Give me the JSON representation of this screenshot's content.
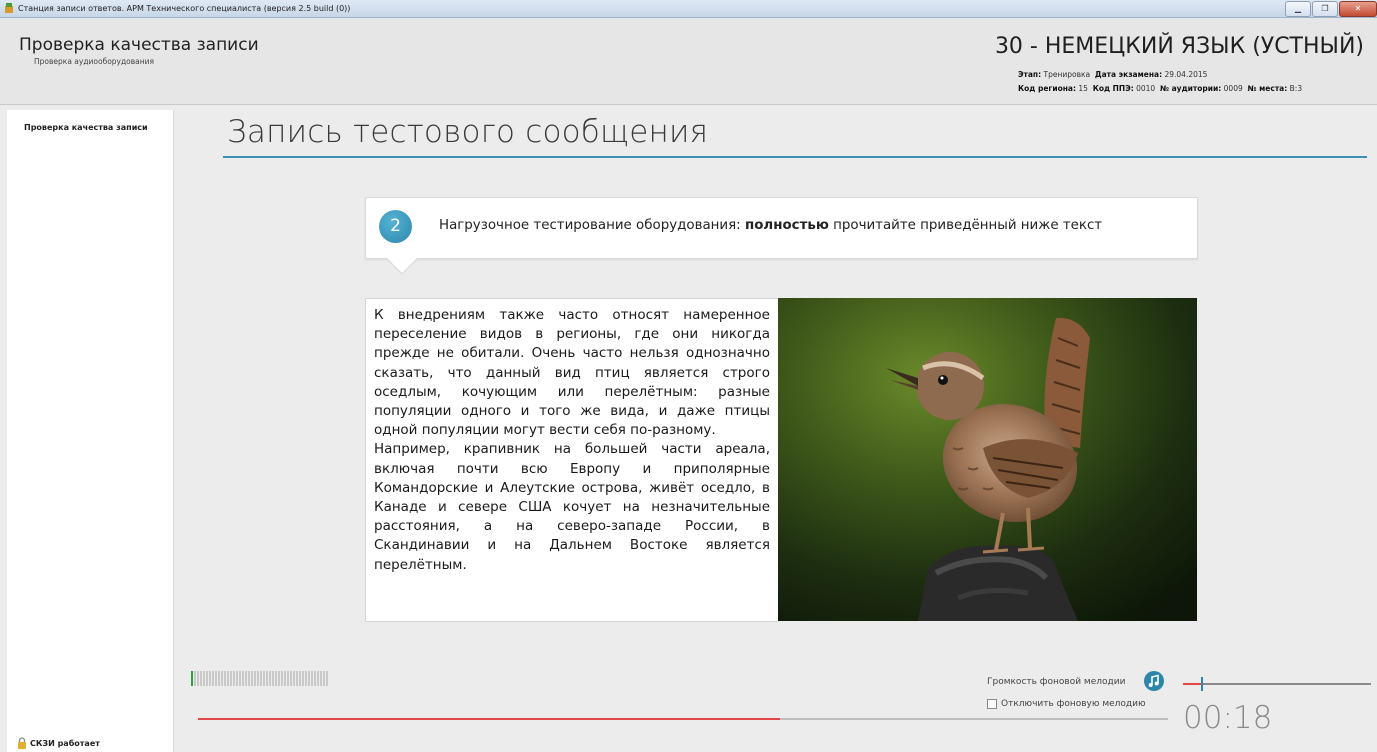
{
  "window": {
    "title": "Станция записи ответов. АРМ Технического специалиста (версия 2.5 build (0))",
    "minimize_icon": "minimize-icon",
    "restore_icon": "restore-icon",
    "close_icon": "close-icon"
  },
  "header": {
    "title": "Проверка качества записи",
    "subtitle": "Проверка аудиооборудования",
    "exam_title": "30 - НЕМЕЦКИЙ ЯЗЫК (УСТНЫЙ)",
    "stage_label": "Этап:",
    "stage_value": "Тренировка",
    "date_label": "Дата экзамена:",
    "date_value": "29.04.2015",
    "region_label": "Код региона:",
    "region_value": "15",
    "ppe_label": "Код ППЭ:",
    "ppe_value": "0010",
    "room_label": "№ аудитории:",
    "room_value": "0009",
    "seat_label": "№ места:",
    "seat_value": "В:3"
  },
  "sidebar": {
    "items": [
      {
        "label": "Проверка качества записи"
      }
    ],
    "status_text": "СКЗИ работает"
  },
  "main": {
    "heading": "Запись тестового сообщения",
    "step_number": "2",
    "instruction_pre": "Нагрузочное тестирование оборудования: ",
    "instruction_bold": "полностью",
    "instruction_post": " прочитайте приведённый ниже текст",
    "paragraph1": "К внедрениям также часто относят намеренное переселение видов в регионы, где они никогда прежде не обитали. Очень часто нельзя однозначно сказать, что данный вид птиц является строго оседлым, кочующим или перелётным: разные популяции одного и того же вида, и даже птицы одной популяции могут вести себя по-разному.",
    "paragraph2": "Например, крапивник на большей части ареала, включая почти всю Европу и приполярные Командорские и Алеутские острова, живёт оседло, в Канаде и севере США кочует на незначительные расстояния, а на северо-западе России, в Скандинавии и на Дальнем Востоке является перелётным."
  },
  "recorder": {
    "level_segments_total": 46,
    "level_segments_on": 1,
    "progress": 0.6,
    "volume_label": "Громкость фоновой мелодии",
    "volume_level": 0.1,
    "mute_label": "Отключить фоновую мелодию",
    "mute_checked": false,
    "timer": "00:18",
    "colors": {
      "accent": "#2d86aa",
      "progress": "#e34646",
      "level_on": "#2aa13c"
    }
  }
}
